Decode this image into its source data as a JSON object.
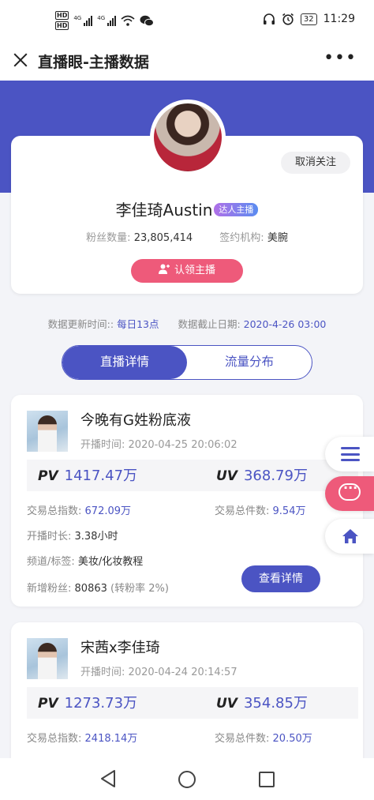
{
  "status_bar": {
    "hd1": "HD",
    "hd2": "HD",
    "net1": "4G",
    "net2": "4G",
    "battery": "32",
    "time": "11:29",
    "icons": [
      "headphones-icon",
      "alarm-icon",
      "wifi-icon",
      "wechat-icon"
    ]
  },
  "title_bar": {
    "title": "直播眼-主播数据",
    "more": "•••"
  },
  "profile": {
    "unfollow_label": "取消关注",
    "name": "李佳琦Austin",
    "tag": "达人主播",
    "fans_label": "粉丝数量:",
    "fans_value": "23,805,414",
    "org_label": "签约机构:",
    "org_value": "美腕",
    "claim_label": "认领主播"
  },
  "update_info": {
    "update_label": "数据更新时间::",
    "update_value": "每日13点",
    "deadline_label": "数据截止日期:",
    "deadline_value": "2020-4-26 03:00"
  },
  "tabs": [
    {
      "label": "直播详情",
      "active": true
    },
    {
      "label": "流量分布",
      "active": false
    }
  ],
  "lives": [
    {
      "title": "今晚有G姓粉底液",
      "start_label": "开播时间:",
      "start_time": "2020-04-25 20:06:02",
      "pv_label": "PV",
      "pv": "1417.47万",
      "uv_label": "UV",
      "uv": "368.79万",
      "index_label": "交易总指数:",
      "index_value": "672.09万",
      "count_label": "交易总件数:",
      "count_value": "9.54万",
      "duration_label": "开播时长:",
      "duration_value": "3.38小时",
      "channel_label": "频道/标签:",
      "channel_value": "美妆/化妆教程",
      "newfans_label": "新增粉丝:",
      "newfans_value": "80863",
      "conversion": "(转粉率 2%)",
      "detail_label": "查看详情"
    },
    {
      "title": "宋茜x李佳琦",
      "start_label": "开播时间:",
      "start_time": "2020-04-24 20:14:57",
      "pv_label": "PV",
      "pv": "1273.73万",
      "uv_label": "UV",
      "uv": "354.85万",
      "index_label": "交易总指数:",
      "index_value": "2418.14万",
      "count_label": "交易总件数:",
      "count_value": "20.50万"
    }
  ],
  "colors": {
    "primary": "#4b54c3",
    "pink": "#ee5a7a",
    "background": "#f3f4f8"
  }
}
